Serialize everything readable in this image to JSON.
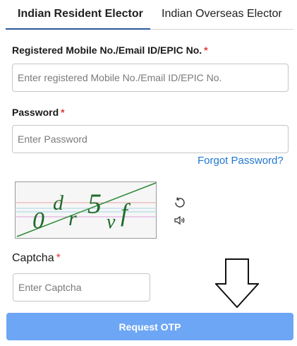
{
  "tabs": [
    {
      "label": "Indian Resident Elector",
      "active": true
    },
    {
      "label": "Indian Overseas Elector",
      "active": false
    }
  ],
  "form": {
    "mobile_label": "Registered Mobile No./Email ID/EPIC No.",
    "mobile_placeholder": "Enter registered Mobile No./Email ID/EPIC No.",
    "password_label": "Password",
    "password_placeholder": "Enter Password",
    "forgot_password": "Forgot Password?",
    "captcha_text": "0dr5vf",
    "captcha_label": "Captcha",
    "captcha_placeholder": "Enter Captcha",
    "required_mark": "*",
    "submit_label": "Request OTP"
  },
  "icons": {
    "refresh": "refresh-icon",
    "audio": "speaker-icon",
    "pointer": "down-arrow-icon"
  },
  "colors": {
    "accent": "#2c5aa0",
    "link": "#1f77d1",
    "required": "#e53935",
    "button_bg": "#6ea6f6",
    "captcha_text": "#1f6b2a"
  }
}
